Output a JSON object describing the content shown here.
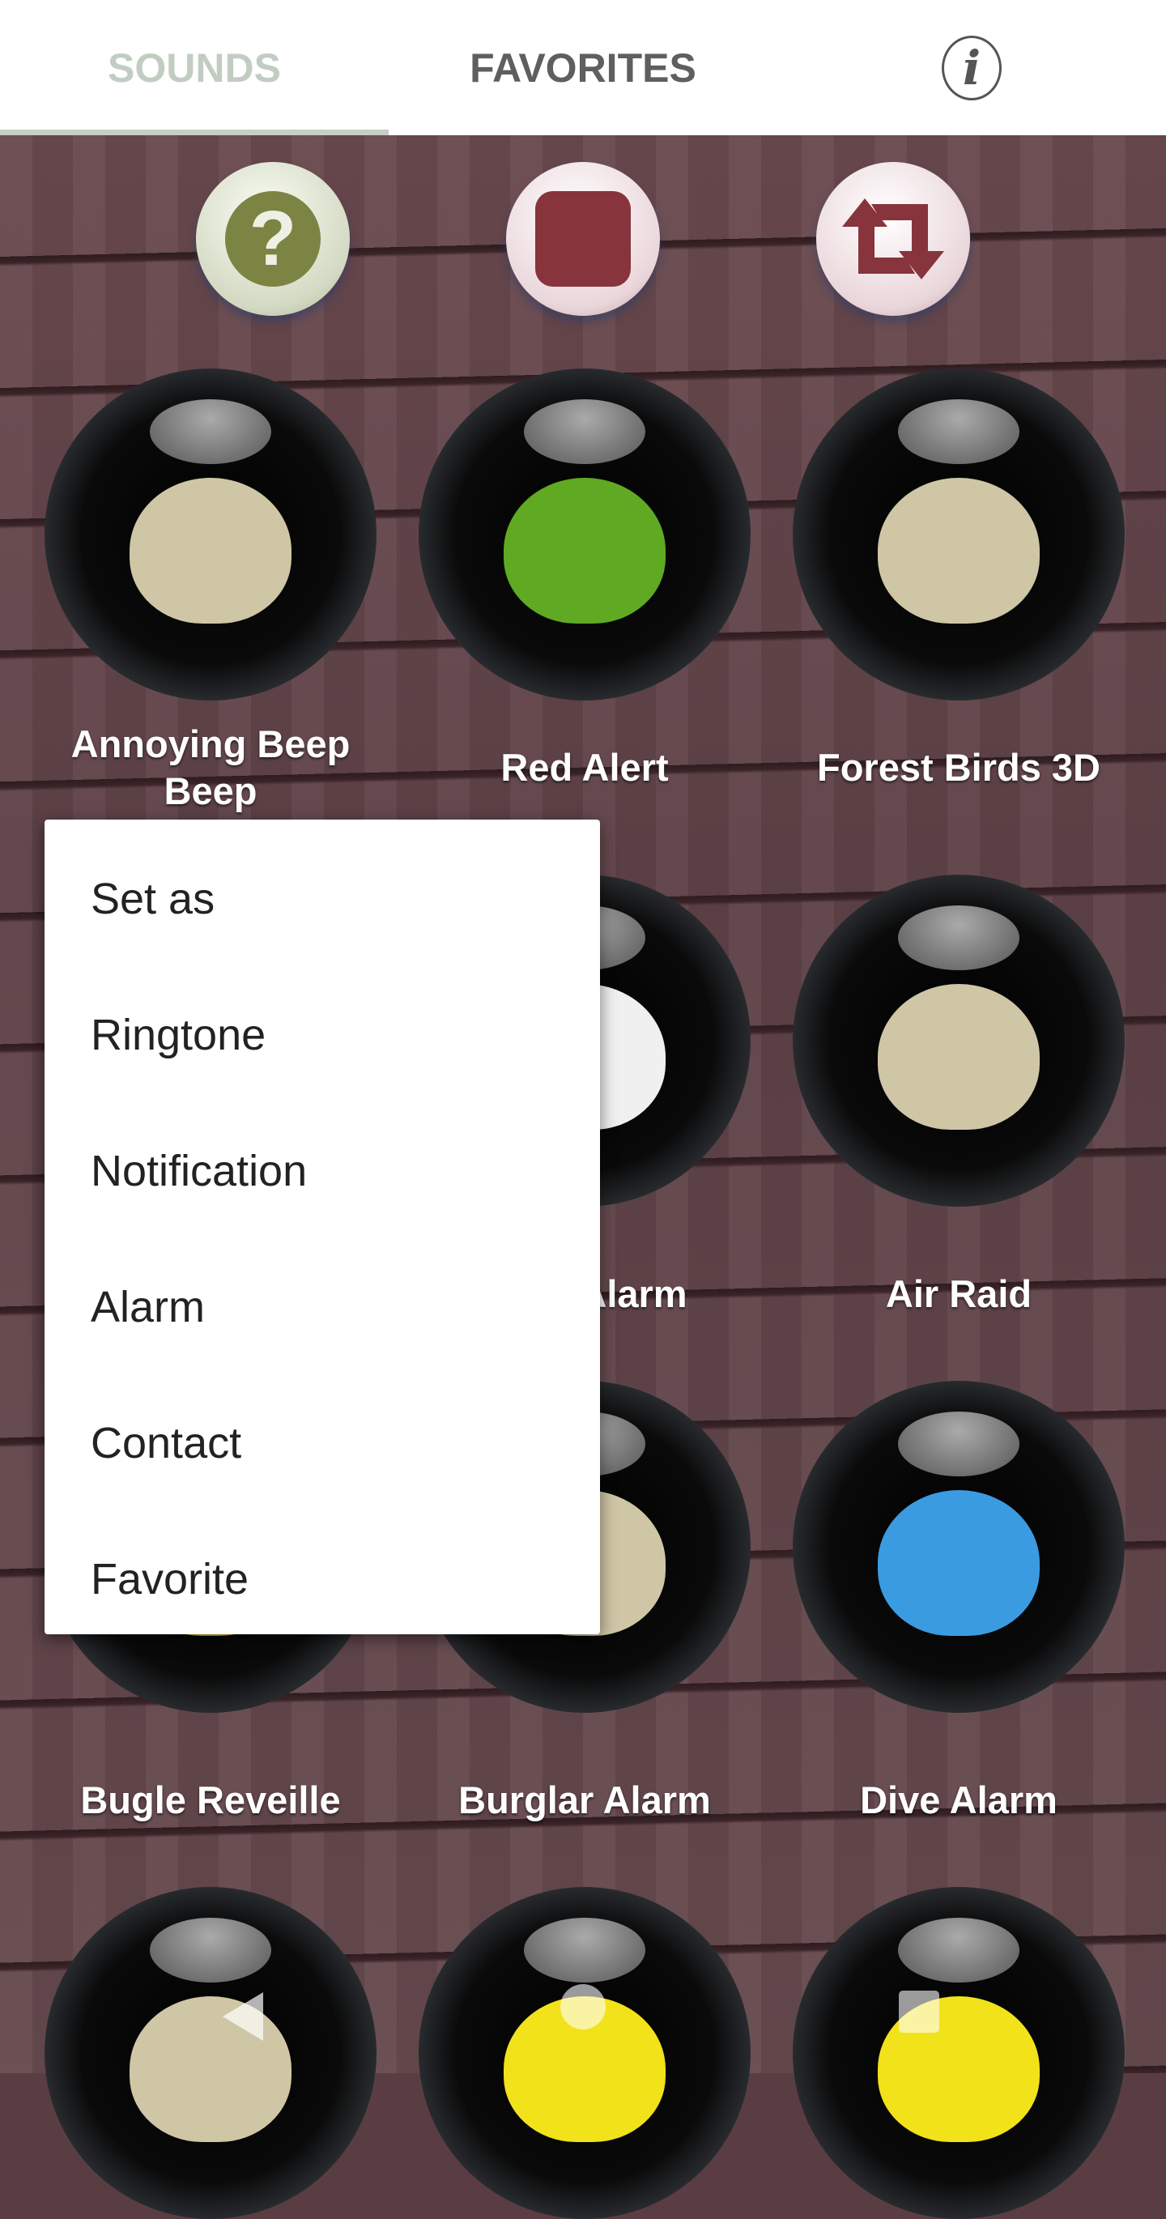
{
  "tabs": {
    "sounds": "SOUNDS",
    "favorites": "FAVORITES",
    "info_icon": "info-icon",
    "active": "SOUNDS"
  },
  "controls": [
    {
      "icon": "help-icon"
    },
    {
      "icon": "stop-icon"
    },
    {
      "icon": "repeat-icon"
    }
  ],
  "sounds": [
    {
      "label": "Annoying Beep Beep",
      "face": "#cfc6a6"
    },
    {
      "label": "Red Alert",
      "face": "#5faa22"
    },
    {
      "label": "Forest Birds 3D",
      "face": "#cfc6a6"
    },
    {
      "label": "",
      "face": "#cfc6a6"
    },
    {
      "label": "Alarm",
      "face": "#f0f0f0"
    },
    {
      "label": "Air Raid",
      "face": "#cfc6a6"
    },
    {
      "label": "Bugle Reveille",
      "face": "#e0b030"
    },
    {
      "label": "Burglar Alarm",
      "face": "#cfc6a6"
    },
    {
      "label": "Dive Alarm",
      "face": "#3a9be0"
    },
    {
      "label": "",
      "face": "#cfc6a6"
    },
    {
      "label": "",
      "face": "#f2e21a"
    },
    {
      "label": "",
      "face": "#f2e21a"
    }
  ],
  "context_menu": {
    "title": "Set as",
    "items": [
      "Ringtone",
      "Notification",
      "Alarm",
      "Contact",
      "Favorite"
    ]
  },
  "navbar": {
    "back": "back-icon",
    "home": "home-icon",
    "recents": "recents-icon"
  }
}
